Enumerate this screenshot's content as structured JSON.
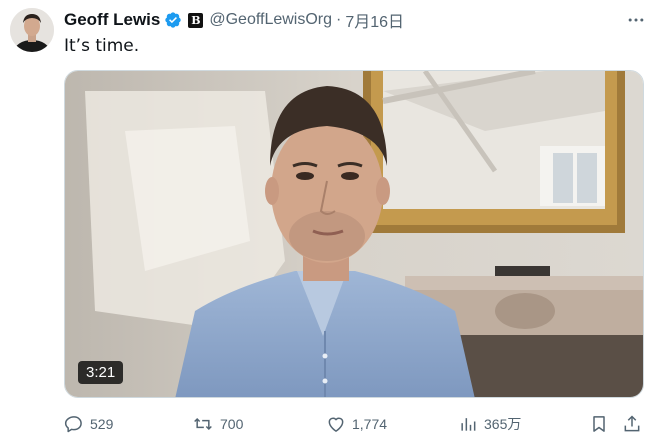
{
  "author": {
    "name": "Geoff Lewis",
    "handle": "@GeoffLewisOrg",
    "affiliate_badge": "B"
  },
  "date": "7月16日",
  "separator": "·",
  "tweet_text": "It’s time.",
  "video": {
    "duration": "3:21"
  },
  "actions": {
    "replies": "529",
    "reposts": "700",
    "likes": "1,774",
    "views": "365万"
  },
  "colors": {
    "verified": "#1d9bf0",
    "secondary_text": "#536471",
    "primary_text": "#0f1419"
  },
  "icons": [
    "verified-badge-icon",
    "more-options-icon",
    "reply-icon",
    "repost-icon",
    "like-icon",
    "views-icon",
    "bookmark-icon",
    "share-icon"
  ]
}
